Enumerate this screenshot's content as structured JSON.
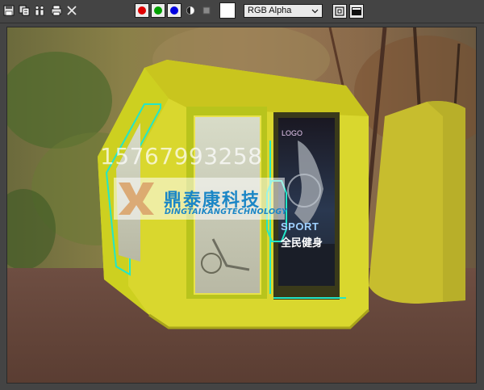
{
  "toolbar": {
    "icons": [
      "save-icon",
      "clone-icon",
      "people-icon",
      "print-icon",
      "close-icon"
    ],
    "channels": [
      {
        "name": "red-channel",
        "color": "#e00000"
      },
      {
        "name": "green-channel",
        "color": "#00a000"
      },
      {
        "name": "blue-channel",
        "color": "#0000e0"
      }
    ],
    "channel_display": "RGB Alpha",
    "swatch_color": "#ffffff"
  },
  "watermark": {
    "phone": "15767993258",
    "brand_cn": "鼎泰康科技",
    "brand_en": "DINGTAIKANGTECHNOLOGY"
  },
  "poster": {
    "logo": "LOGO",
    "sport": "SPORT",
    "slogan": "全民健身"
  }
}
